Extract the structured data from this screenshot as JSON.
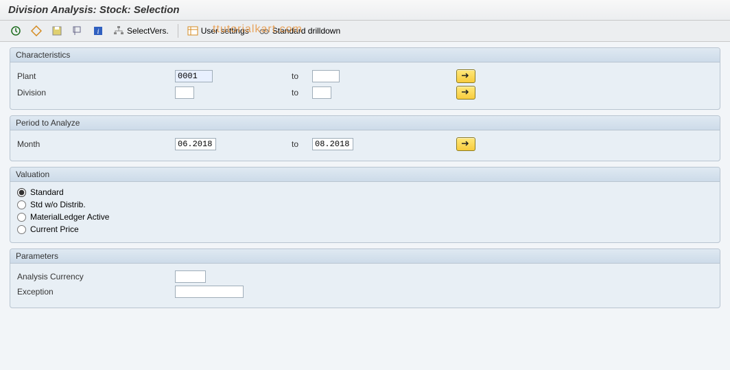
{
  "header": {
    "title": "Division Analysis: Stock: Selection"
  },
  "toolbar": {
    "select_vers": "SelectVers.",
    "user_settings": "User settings",
    "standard_drilldown": "Standard drilldown"
  },
  "watermark": "ttutorialkart.com",
  "groups": {
    "characteristics": {
      "title": "Characteristics",
      "plant_label": "Plant",
      "plant_from": "0001",
      "plant_to": "",
      "to_label": "to",
      "division_label": "Division",
      "division_from": "",
      "division_to": ""
    },
    "period": {
      "title": "Period to Analyze",
      "month_label": "Month",
      "month_from": "06.2018",
      "to_label": "to",
      "month_to": "08.2018"
    },
    "valuation": {
      "title": "Valuation",
      "opt_standard": "Standard",
      "opt_std_wo": "Std w/o Distrib.",
      "opt_ml": "MaterialLedger Active",
      "opt_curr": "Current Price"
    },
    "parameters": {
      "title": "Parameters",
      "currency_label": "Analysis Currency",
      "currency_value": "",
      "exception_label": "Exception",
      "exception_value": ""
    }
  }
}
